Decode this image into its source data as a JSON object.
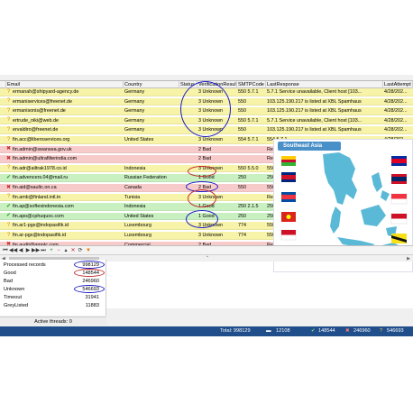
{
  "grid": {
    "columns": [
      "Email",
      "Country",
      "Status",
      "VerificationResult",
      "SMTPCode",
      "LastResponse",
      "LastAttempt"
    ],
    "rows": [
      {
        "email": "ermanah@shipyard-agency.de",
        "country": "Germany",
        "result": "3 Unknown",
        "smtp": "550 5.7.1",
        "response": "5.7.1 Service unavailable, Client host [103...",
        "attempt": "4/28/202...",
        "tone": "unknown",
        "icon": "question"
      },
      {
        "email": "ermaniservices@freenet.de",
        "country": "Germany",
        "result": "3 Unknown",
        "smtp": "550",
        "response": "103.125.190.217 is listed at XBL Spamhaus",
        "attempt": "4/28/202...",
        "tone": "unknown",
        "icon": "question"
      },
      {
        "email": "ermanisonis@freenet.de",
        "country": "Germany",
        "result": "3 Unknown",
        "smtp": "550",
        "response": "103.125.190.217 is listed at XBL Spamhaus",
        "attempt": "4/28/202...",
        "tone": "unknown",
        "icon": "question"
      },
      {
        "email": "ertrude_niki@web.de",
        "country": "Germany",
        "result": "3 Unknown",
        "smtp": "550 5.7.1",
        "response": "5.7.1 Service unavailable, Client host [103...",
        "attempt": "4/28/202...",
        "tone": "unknown",
        "icon": "question"
      },
      {
        "email": "ervaldiro@freenet.de",
        "country": "Germany",
        "result": "3 Unknown",
        "smtp": "550",
        "response": "103.125.190.217 is listed at XBL Spamhaus",
        "attempt": "4/28/202...",
        "tone": "unknown",
        "icon": "question"
      },
      {
        "email": "fin.acc@liberoservices.org",
        "country": "United States",
        "result": "3 Unknown",
        "smtp": "554 5.7.1",
        "response": "554 5.7.1 ...",
        "attempt": "4/28/202...",
        "tone": "unknown",
        "icon": "question"
      },
      {
        "email": "fin.admin@swansea.gov.uk",
        "country": "",
        "result": "2 Bad",
        "smtp": "",
        "response": "Reso",
        "attempt": "",
        "tone": "bad",
        "icon": "cross"
      },
      {
        "email": "fin.admin@ultrafilterindia.com",
        "country": "",
        "result": "2 Bad",
        "smtp": "",
        "response": "Reso",
        "attempt": "",
        "tone": "bad",
        "icon": "cross"
      },
      {
        "email": "fin.adr@ailtrak1978.co.id",
        "country": "Indonesia",
        "result": "3 Unknown",
        "smtp": "550 5.5.0",
        "response": "550",
        "attempt": "",
        "tone": "unknown",
        "icon": "question"
      },
      {
        "email": "fin.advencers.04@mail.ru",
        "country": "Russian Federation",
        "result": "1 Good",
        "smtp": "250",
        "response": "250",
        "attempt": "",
        "tone": "good",
        "icon": "check"
      },
      {
        "email": "fin.aid@saultc.on.ca",
        "country": "Canada",
        "result": "2 Bad",
        "smtp": "550",
        "response": "550",
        "attempt": "",
        "tone": "bad",
        "icon": "cross"
      },
      {
        "email": "fin.amb@finland.intl.tn",
        "country": "Tunisia",
        "result": "3 Unknown",
        "smtp": "",
        "response": "Reso",
        "attempt": "",
        "tone": "unknown",
        "icon": "question"
      },
      {
        "email": "fin.ap@softexindonesia.com",
        "country": "Indonesia",
        "result": "1 Good",
        "smtp": "250 2.1.5",
        "response": "250",
        "attempt": "",
        "tone": "good",
        "icon": "check"
      },
      {
        "email": "fin.apo@cphuquoc.com",
        "country": "United States",
        "result": "1 Good",
        "smtp": "250",
        "response": "250",
        "attempt": "",
        "tone": "good",
        "icon": "check"
      },
      {
        "email": "fin.ar1-pgs@indopasifik.id",
        "country": "Luxembourg",
        "result": "3 Unknown",
        "smtp": "774",
        "response": "550",
        "attempt": "",
        "tone": "unknown",
        "icon": "question"
      },
      {
        "email": "fin.ar-pgs@indopasifik.id",
        "country": "Luxembourg",
        "result": "3 Unknown",
        "smtp": "774",
        "response": "550",
        "attempt": "",
        "tone": "unknown",
        "icon": "question"
      },
      {
        "email": "fin.audit@gmntc.com",
        "country": "Commercial",
        "result": "2 Bad",
        "smtp": "",
        "response": "Reso",
        "attempt": "",
        "tone": "bad",
        "icon": "cross"
      }
    ]
  },
  "map": {
    "title": "Southeast Asia"
  },
  "stats": [
    {
      "label": "Processed records",
      "value": "998129"
    },
    {
      "label": "Good",
      "value": "148544"
    },
    {
      "label": "Bad",
      "value": "246960"
    },
    {
      "label": "Unknown",
      "value": "546693"
    },
    {
      "label": "Timeout",
      "value": "31941"
    },
    {
      "label": "GreyListed",
      "value": "11883"
    }
  ],
  "threads_label": "Active threads: 0",
  "statusbar": {
    "total": "Total: 998129",
    "timeout": "12108",
    "good": "148544",
    "bad": "246960",
    "unknown": "546693"
  },
  "colors": {
    "good": "#c8f0c0",
    "bad": "#f8cbcb",
    "unknown": "#f7f3a8",
    "statusbar": "#1f4e8a"
  }
}
